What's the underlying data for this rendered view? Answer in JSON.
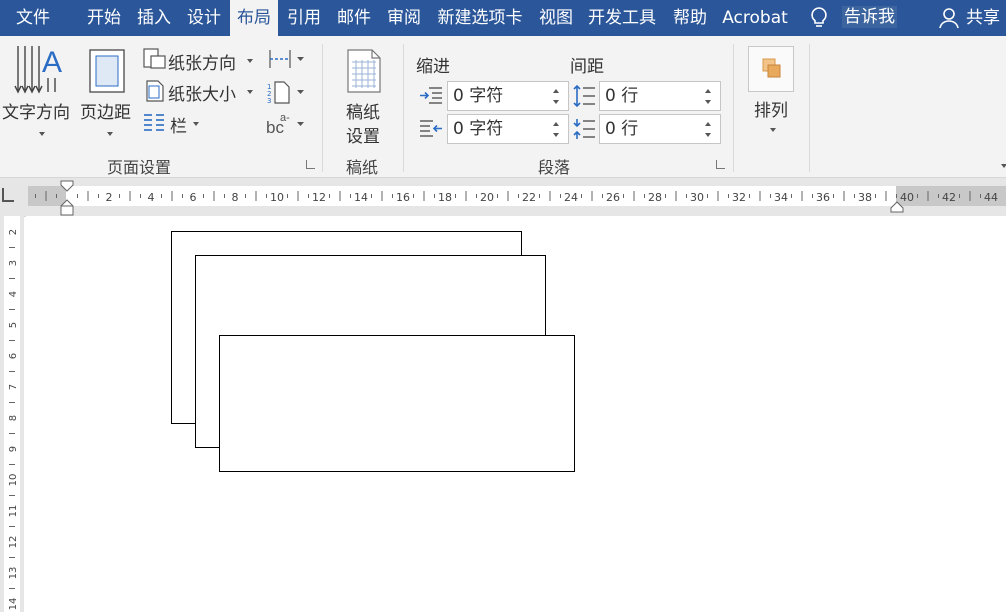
{
  "tabs": [
    {
      "label": "文件",
      "active": false
    },
    {
      "label": "开始",
      "active": false
    },
    {
      "label": "插入",
      "active": false
    },
    {
      "label": "设计",
      "active": false
    },
    {
      "label": "布局",
      "active": true
    },
    {
      "label": "引用",
      "active": false
    },
    {
      "label": "邮件",
      "active": false
    },
    {
      "label": "审阅",
      "active": false
    },
    {
      "label": "新建选项卡",
      "active": false
    },
    {
      "label": "视图",
      "active": false
    },
    {
      "label": "开发工具",
      "active": false
    },
    {
      "label": "帮助",
      "active": false
    },
    {
      "label": "Acrobat",
      "active": false
    }
  ],
  "tell_me": "告诉我",
  "share": "共享",
  "page_setup": {
    "text_direction": "文字方向",
    "margins": "页边距",
    "orientation": "纸张方向",
    "size": "纸张大小",
    "columns": "栏",
    "group_label": "页面设置"
  },
  "manuscript": {
    "line1": "稿纸",
    "line2": "设置",
    "group_label": "稿纸"
  },
  "paragraph": {
    "indent_label": "缩进",
    "spacing_label": "间距",
    "indent_left": "0 字符",
    "indent_right": "0 字符",
    "spacing_before": "0 行",
    "spacing_after": "0 行",
    "group_label": "段落"
  },
  "arrange": {
    "label": "排列"
  },
  "ruler": {
    "h_numbers": [
      "2",
      "4",
      "6",
      "8",
      "10",
      "12",
      "14",
      "16",
      "18",
      "20",
      "22",
      "24",
      "26",
      "28",
      "30",
      "32",
      "34",
      "36",
      "38",
      "40",
      "42",
      "44"
    ],
    "v_numbers": [
      "2",
      "3",
      "4",
      "5",
      "6",
      "7",
      "8",
      "9",
      "10",
      "11",
      "12",
      "13",
      "14"
    ]
  },
  "colors": {
    "tab_bar": "#2b579a",
    "ribbon": "#f3f3f3",
    "ruler": "#e6e6e6"
  }
}
